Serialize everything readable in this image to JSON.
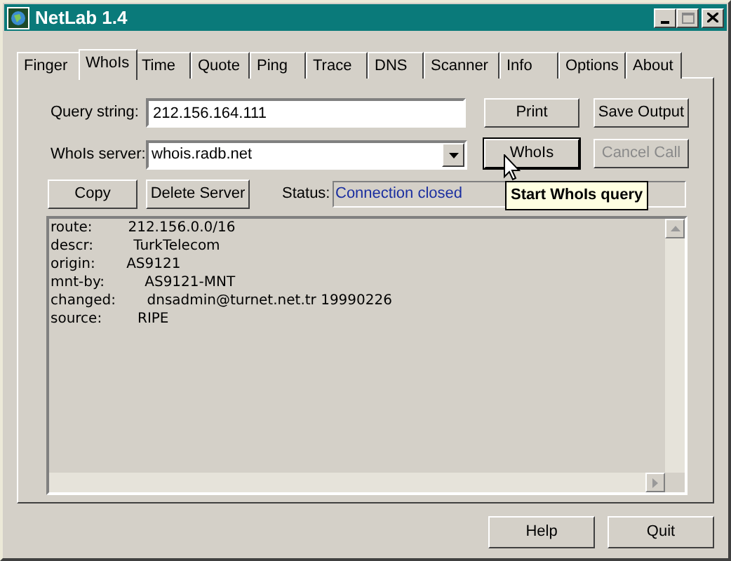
{
  "window": {
    "title": "NetLab 1.4"
  },
  "tabs": [
    {
      "label": "Finger",
      "selected": false
    },
    {
      "label": "WhoIs",
      "selected": true
    },
    {
      "label": "Time",
      "selected": false
    },
    {
      "label": "Quote",
      "selected": false
    },
    {
      "label": "Ping",
      "selected": false
    },
    {
      "label": "Trace",
      "selected": false
    },
    {
      "label": "DNS",
      "selected": false
    },
    {
      "label": "Scanner",
      "selected": false
    },
    {
      "label": "Info",
      "selected": false
    },
    {
      "label": "Options",
      "selected": false
    },
    {
      "label": "About",
      "selected": false
    }
  ],
  "query": {
    "label": "Query string:",
    "value": "212.156.164.111"
  },
  "server": {
    "label": "WhoIs server:",
    "value": "whois.radb.net"
  },
  "buttons": {
    "print": {
      "label": "Print",
      "disabled": false
    },
    "save": {
      "label": "Save Output",
      "disabled": false
    },
    "whois": {
      "label": "WhoIs",
      "disabled": false,
      "focused": true
    },
    "cancel": {
      "label": "Cancel Call",
      "disabled": true
    },
    "copy": {
      "label": "Copy",
      "disabled": false
    },
    "delete": {
      "label": "Delete Server",
      "disabled": false
    }
  },
  "status": {
    "label": "Status:",
    "value": "Connection closed"
  },
  "tooltip": "Start WhoIs query",
  "output": [
    "route:        212.156.0.0/16",
    "descr:         TurkTelecom",
    "origin:       AS9121",
    "mnt-by:         AS9121-MNT",
    "changed:       dnsadmin@turnet.net.tr 19990226",
    "source:        RIPE"
  ],
  "footer_buttons": [
    "Help",
    "Quit"
  ]
}
